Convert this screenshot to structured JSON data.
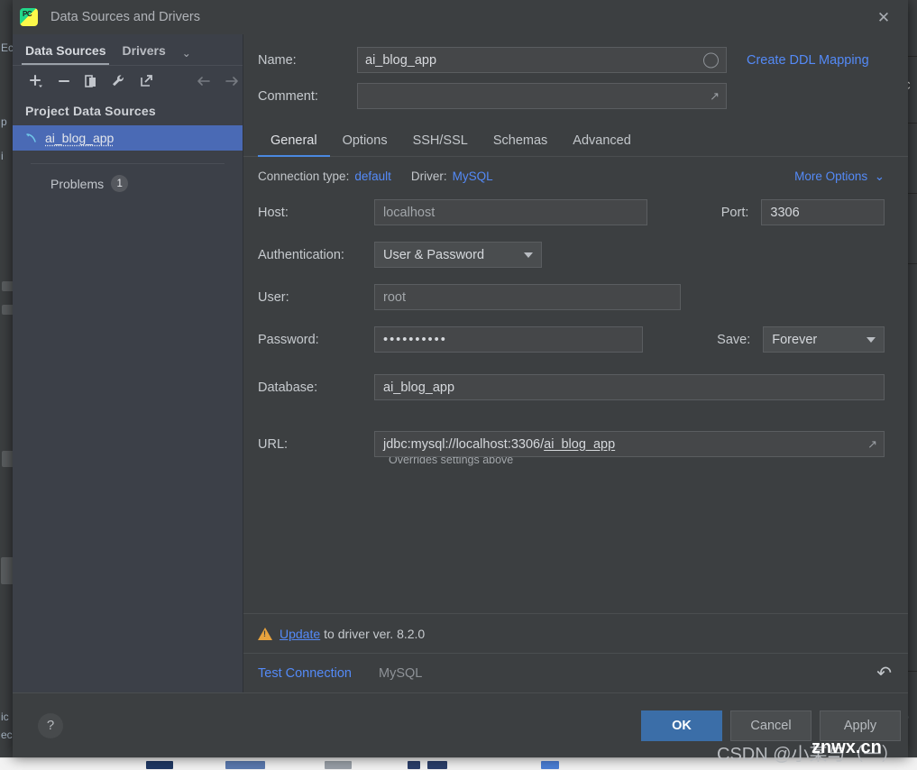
{
  "window": {
    "title": "Data Sources and Drivers",
    "app_icon": "pycharm-icon",
    "close_icon": "close-icon"
  },
  "left_panel": {
    "tabs": [
      {
        "label": "Data Sources",
        "active": true
      },
      {
        "label": "Drivers",
        "active": false
      }
    ],
    "tabs_chevron": "chevron-down-icon",
    "toolbar": [
      {
        "name": "add-icon",
        "glyph": "+"
      },
      {
        "name": "remove-icon",
        "glyph": "−"
      },
      {
        "name": "duplicate-icon",
        "glyph": "❐"
      },
      {
        "name": "wrench-icon",
        "glyph": "🔧"
      },
      {
        "name": "jump-to-icon",
        "glyph": "↗"
      },
      {
        "name": "back-arrow-icon",
        "glyph": "←"
      },
      {
        "name": "forward-arrow-icon",
        "glyph": "→"
      }
    ],
    "section_title": "Project Data Sources",
    "data_sources": [
      {
        "label": "ai_blog_app",
        "icon": "mysql-icon",
        "selected": true
      }
    ],
    "problems": {
      "label": "Problems",
      "count": "1"
    }
  },
  "header": {
    "name_label": "Name:",
    "name_value": "ai_blog_app",
    "name_indicator": "circle-indicator-icon",
    "comment_label": "Comment:",
    "comment_value": "",
    "comment_expand_icon": "expand-icon",
    "create_ddl_link": "Create DDL Mapping"
  },
  "tabs": [
    {
      "label": "General",
      "active": true
    },
    {
      "label": "Options",
      "active": false
    },
    {
      "label": "SSH/SSL",
      "active": false
    },
    {
      "label": "Schemas",
      "active": false
    },
    {
      "label": "Advanced",
      "active": false
    }
  ],
  "connection": {
    "type_label": "Connection type:",
    "type_value": "default",
    "driver_label": "Driver:",
    "driver_value": "MySQL",
    "more_options": "More Options",
    "more_options_icon": "chevron-down-icon"
  },
  "form": {
    "host_label": "Host:",
    "host_value": "localhost",
    "port_label": "Port:",
    "port_value": "3306",
    "auth_label": "Authentication:",
    "auth_value": "User & Password",
    "user_label": "User:",
    "user_value": "root",
    "password_label": "Password:",
    "password_value": "••••••••••",
    "save_label": "Save:",
    "save_value": "Forever",
    "database_label": "Database:",
    "database_value": "ai_blog_app",
    "url_label": "URL:",
    "url_prefix": "jdbc:mysql://localhost:3306/",
    "url_suffix": "ai_blog_app",
    "url_expand_icon": "expand-icon",
    "url_hint": "Overrides settings above"
  },
  "update_bar": {
    "warning_icon": "warning-icon",
    "link": "Update",
    "text": " to driver ver. 8.2.0"
  },
  "test_bar": {
    "test_connection": "Test Connection",
    "driver_name": "MySQL",
    "refresh_icon": "refresh-icon"
  },
  "buttons": {
    "help": "?",
    "ok": "OK",
    "cancel": "Cancel",
    "apply": "Apply"
  },
  "watermark": {
    "csdn": "CSDN @小某与（一）",
    "site": "znwx.cn"
  },
  "colors": {
    "dialog_bg": "#3c3f41",
    "sidebar_bg": "#3c4048",
    "accent_blue": "#548af7",
    "selection_blue": "#4a6ab5",
    "tab_underline": "#4a88e0",
    "primary_button": "#3b6ea8",
    "warning_amber": "#e8a33d"
  }
}
